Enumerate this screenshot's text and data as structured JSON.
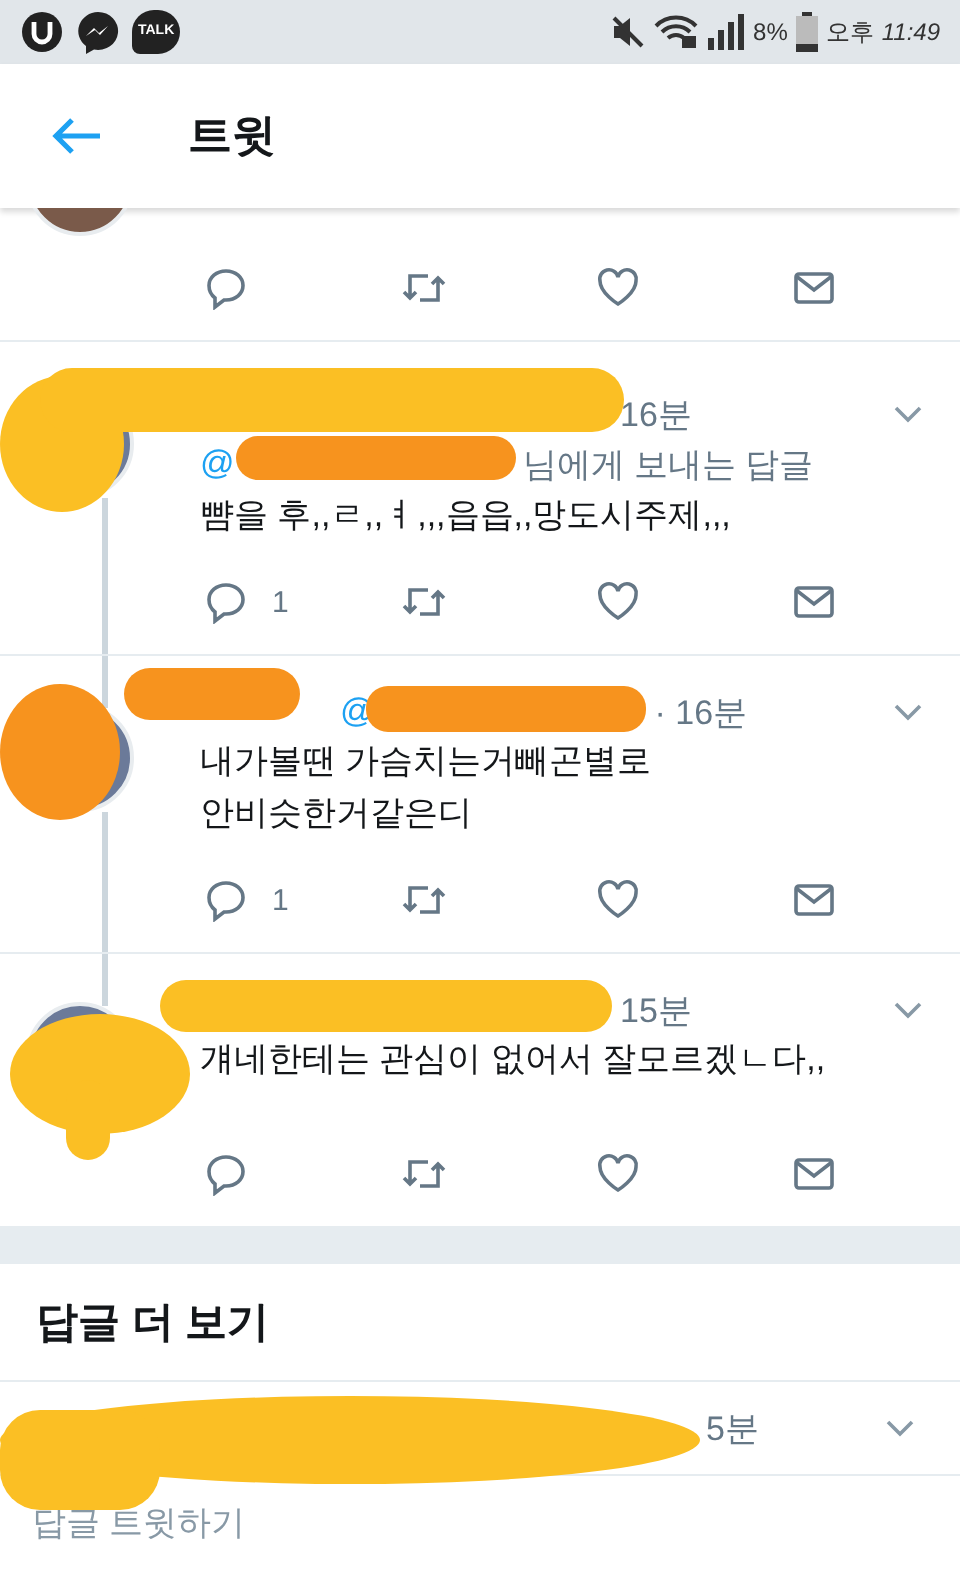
{
  "status_bar": {
    "app_badge": "TALK",
    "battery": "8%",
    "ampm": "오후",
    "time": "11:49"
  },
  "header": {
    "title": "트윗"
  },
  "tweets": [
    {
      "kind": "partial",
      "thread_above": false,
      "thread_below": false
    },
    {
      "kind": "reply",
      "thread_above": false,
      "thread_below": true,
      "time": "16분",
      "reply_to": {
        "handle": "@",
        "label": "님에게 보내는 답글"
      },
      "text": "뺨을 후,,ㄹ,,ㅕ,,,읍읍,,망도시주제,,,",
      "reply_count": "1"
    },
    {
      "kind": "reply",
      "thread_above": true,
      "thread_below": true,
      "handle": "@",
      "time": "· 16분",
      "text": "내가볼땐 가슴치는거빼곤별로\n안비슷한거같은디",
      "reply_count": "1"
    },
    {
      "kind": "reply",
      "thread_above": true,
      "thread_below": false,
      "time": "15분",
      "text": "걔네한테는 관심이 없어서 잘모르겠ㄴ다,,"
    }
  ],
  "more_replies": {
    "title": "답글 더 보기",
    "rows": [
      {
        "time": "5분"
      }
    ]
  },
  "compose": {
    "placeholder": "답글 트윗하기"
  }
}
